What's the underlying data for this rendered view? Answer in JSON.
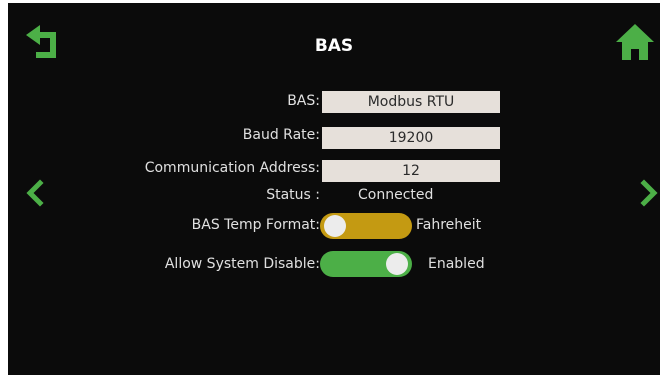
{
  "header": {
    "title": "BAS",
    "back_icon": "return-arrow-icon",
    "home_icon": "home-icon"
  },
  "navigation": {
    "prev_icon": "chevron-left-icon",
    "next_icon": "chevron-right-icon"
  },
  "settings": {
    "bas": {
      "label": "BAS:",
      "value": "Modbus RTU"
    },
    "baud_rate": {
      "label": "Baud Rate:",
      "value": "19200"
    },
    "comm_address": {
      "label": "Communication Address:",
      "value": "12"
    },
    "status": {
      "label": "Status :",
      "value": "Connected"
    },
    "temp_format": {
      "label": "BAS Temp Format:",
      "state_text": "Fahreheit",
      "on": true
    },
    "system_disable": {
      "label": "Allow System Disable:",
      "state_text": "Enabled",
      "on": true
    }
  },
  "colors": {
    "background": "#0b0b0b",
    "accent_green": "#4caf47",
    "toggle_gold": "#c49a12",
    "field_bg": "#e6e0da"
  }
}
